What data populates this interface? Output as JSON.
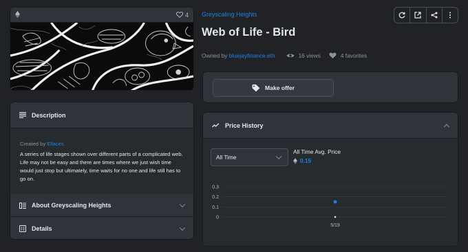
{
  "asset": {
    "favorites_count": "4",
    "collection_name": "Greyscaling Heights",
    "title": "Web of Life - Bird",
    "owner_prefix": "Owned by",
    "owner": "bluejayfinance.eth",
    "views": "16 views",
    "favorites": "4 favorites"
  },
  "description": {
    "header": "Description",
    "created_prefix": "Created by",
    "creator": "Ellaces",
    "text": "A series of life stages shown over different parts of a complicated web. Life may not be easy and there are times where we just wish time would just stop but ultimately, time waits for no one and life still has to go on."
  },
  "about": {
    "header": "About Greyscaling Heights"
  },
  "details": {
    "header": "Details"
  },
  "offer": {
    "label": "Make offer"
  },
  "price_history": {
    "header": "Price History",
    "range_selected": "All Time",
    "avg_label": "All Time Avg. Price",
    "avg_value": "0.15"
  },
  "icons": {
    "eth": "ethereum-icon",
    "heart": "heart-icon",
    "refresh": "refresh-icon",
    "external": "external-link-icon",
    "share": "share-icon",
    "more": "more-vertical-icon",
    "tag": "tag-icon",
    "description": "list-icon",
    "about": "about-icon",
    "details": "details-icon",
    "trend": "trend-icon",
    "views": "eye-icon"
  },
  "colors": {
    "accent": "#2081e2",
    "background": "#202225",
    "panel": "#303339"
  },
  "chart_data": {
    "type": "scatter",
    "categories": [
      "5/19"
    ],
    "yticks": [
      "0.3",
      "0.2",
      "0.1",
      "0"
    ],
    "ylim": [
      0,
      0.3
    ],
    "series": [
      {
        "x": [
          "5/19"
        ],
        "values": [
          0.15
        ]
      }
    ]
  }
}
